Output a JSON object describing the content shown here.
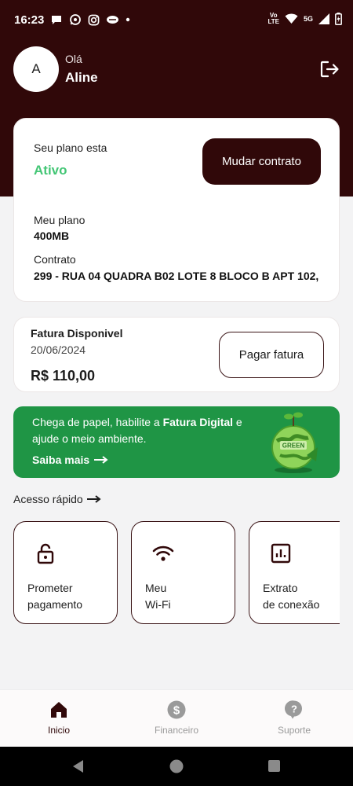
{
  "status_bar": {
    "time": "16:23",
    "notifications": [
      "chat-icon",
      "whatsapp-icon",
      "instagram-icon",
      "cup-icon",
      "dot-icon"
    ],
    "volte_line1": "Vo",
    "volte_line2": "LTE",
    "network": "5G",
    "icons": [
      "wifi-icon",
      "signal-icon",
      "battery-icon"
    ]
  },
  "header": {
    "avatar_initial": "A",
    "greeting": "Olá",
    "user_name": "Aline",
    "logout_icon": "logout-icon"
  },
  "plan": {
    "status_label": "Seu plano esta",
    "status_value": "Ativo",
    "change_button": "Mudar contrato",
    "plan_label": "Meu plano",
    "plan_value": "400MB",
    "contract_label": "Contrato",
    "contract_value": "299 - RUA 04 QUADRA B02 LOTE 8 BLOCO B APT 102,"
  },
  "invoice": {
    "title": "Fatura Disponivel",
    "date": "20/06/2024",
    "amount": "R$ 110,00",
    "pay_button": "Pagar fatura"
  },
  "banner": {
    "text_before": "Chega de papel, habilite a ",
    "text_bold": "Fatura Digital",
    "text_after": " e ajude o meio ambiente.",
    "link": "Saiba mais",
    "image_label": "GREEN"
  },
  "quick_access": {
    "title": "Acesso rápido",
    "items": [
      {
        "line1": "Prometer",
        "line2": "pagamento",
        "icon": "lock-icon"
      },
      {
        "line1": "Meu",
        "line2": "Wi-Fi",
        "icon": "wifi-icon"
      },
      {
        "line1": "Extrato",
        "line2": "de conexão",
        "icon": "chart-icon"
      }
    ]
  },
  "bottom_nav": {
    "items": [
      {
        "label": "Inicio",
        "icon": "home-icon",
        "active": true
      },
      {
        "label": "Financeiro",
        "icon": "dollar-icon",
        "active": false
      },
      {
        "label": "Suporte",
        "icon": "help-icon",
        "active": false
      }
    ]
  },
  "colors": {
    "brand_dark": "#300809",
    "active_green": "#43c675",
    "banner_green": "#1f9545",
    "nav_inactive": "#9a9a9a"
  }
}
